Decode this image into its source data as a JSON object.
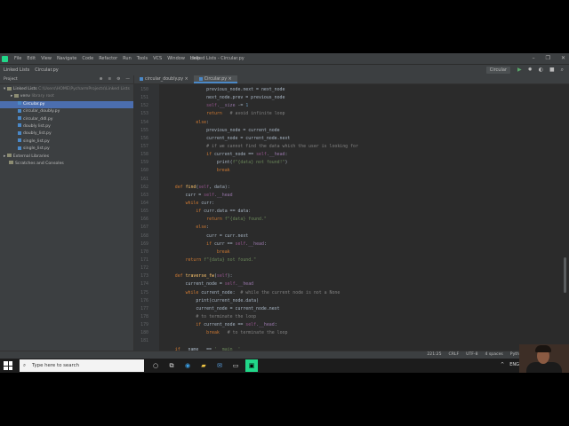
{
  "window": {
    "app_title": "Linked Lists - Circular.py",
    "menu": [
      "File",
      "Edit",
      "View",
      "Navigate",
      "Code",
      "Refactor",
      "Run",
      "Tools",
      "VCS",
      "Window",
      "Help"
    ],
    "controls": [
      "–",
      "❐",
      "✕"
    ]
  },
  "navbar": {
    "breadcrumb_project": "Linked Lists",
    "breadcrumb_file": "Circular.py",
    "run_config": "Circular"
  },
  "project": {
    "header": "Project",
    "tree": [
      {
        "label": "Linked Lists",
        "suffix": "C:\\Users\\HOME\\PycharmProjects\\Linked Lists",
        "type": "root"
      },
      {
        "label": "venv",
        "suffix": "library root",
        "type": "folder"
      },
      {
        "label": "Circular.py",
        "type": "file",
        "selected": true
      },
      {
        "label": "circular_doubly.py",
        "type": "file"
      },
      {
        "label": "circular_ddl.py",
        "type": "file"
      },
      {
        "label": "doubly list.py",
        "type": "file"
      },
      {
        "label": "doubly_list.py",
        "type": "file"
      },
      {
        "label": "single_list.py",
        "type": "file"
      },
      {
        "label": "single_list.py",
        "type": "file"
      },
      {
        "label": "External Libraries",
        "type": "lib"
      },
      {
        "label": "Scratches and Consoles",
        "type": "lib"
      }
    ]
  },
  "tabs": [
    {
      "label": "circular_doubly.py",
      "active": false
    },
    {
      "label": "Circular.py",
      "active": true
    }
  ],
  "code_lines": [
    {
      "n": "150",
      "text": "                previous_node.next = next_node"
    },
    {
      "n": "151",
      "text": "                next_node.prev = previous_node"
    },
    {
      "n": "152",
      "text": "                self.__size -= 1"
    },
    {
      "n": "153",
      "text": "                return   # avoid infinite loop"
    },
    {
      "n": "154",
      "text": "            else:"
    },
    {
      "n": "155",
      "text": "                previous_node = current_node"
    },
    {
      "n": "156",
      "text": "                current_node = current_node.next"
    },
    {
      "n": "157",
      "text": "                # if we cannot find the data which the user is looking for"
    },
    {
      "n": "158",
      "text": "                if current_node == self.__head:"
    },
    {
      "n": "159",
      "text": "                    print(f\"{data} not found!\")"
    },
    {
      "n": "160",
      "text": "                    break"
    },
    {
      "n": "161",
      "text": ""
    },
    {
      "n": "162",
      "text": "    def find(self, data):"
    },
    {
      "n": "163",
      "text": "        curr = self.__head"
    },
    {
      "n": "164",
      "text": "        while curr:"
    },
    {
      "n": "165",
      "text": "            if curr.data == data:"
    },
    {
      "n": "166",
      "text": "                return f\"{data} found.\""
    },
    {
      "n": "167",
      "text": "            else:"
    },
    {
      "n": "168",
      "text": "                curr = curr.next"
    },
    {
      "n": "169",
      "text": "                if curr == self.__head:"
    },
    {
      "n": "170",
      "text": "                    break"
    },
    {
      "n": "171",
      "text": "        return f\"{data} not found.\""
    },
    {
      "n": "172",
      "text": ""
    },
    {
      "n": "173",
      "text": "    def traverse_fw(self):"
    },
    {
      "n": "174",
      "text": "        current_node = self.__head"
    },
    {
      "n": "175",
      "text": "        while current_node:  # while the current node is not a None"
    },
    {
      "n": "176",
      "text": "            print(current_node.data)"
    },
    {
      "n": "177",
      "text": "            current_node = current_node.next"
    },
    {
      "n": "178",
      "text": "            # to terminate the loop"
    },
    {
      "n": "179",
      "text": "            if current_node == self.__head:"
    },
    {
      "n": "180",
      "text": "                break   # to terminate the loop"
    },
    {
      "n": "181",
      "text": ""
    },
    {
      "n": "",
      "text": "    if __name__ == '__main__'"
    }
  ],
  "status": {
    "position": "221:25",
    "line_sep": "CRLF",
    "encoding": "UTF-8",
    "indent": "4 spaces",
    "interpreter": "Pyth"
  },
  "taskbar": {
    "search_placeholder": "Type here to search",
    "tray_lang": "ENG"
  }
}
